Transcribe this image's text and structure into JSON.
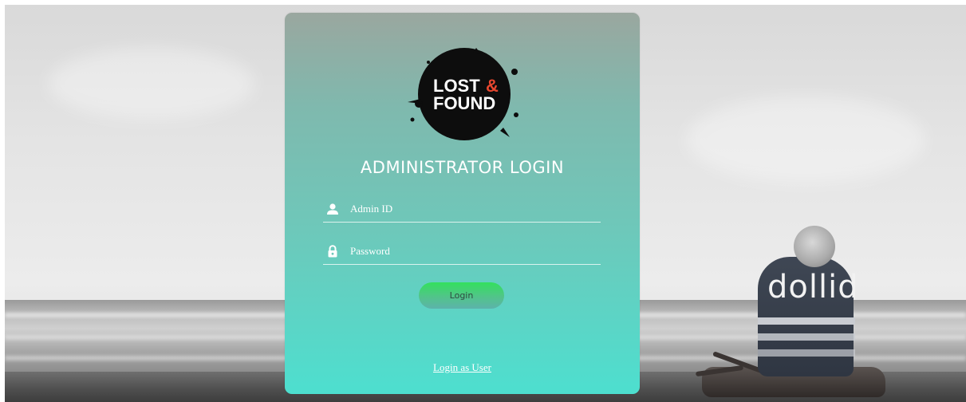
{
  "page": {
    "title": "ADMINISTRATOR LOGIN"
  },
  "logo": {
    "line1": "LOST",
    "ampersand": "&",
    "line2": "FOUND",
    "accent_color": "#e8472f"
  },
  "form": {
    "admin_id": {
      "placeholder": "Admin ID",
      "value": "",
      "icon": "user-icon"
    },
    "password": {
      "placeholder": "Password",
      "value": "",
      "icon": "lock-icon"
    },
    "submit_label": "Login"
  },
  "links": {
    "login_as_user": "Login as User"
  },
  "background": {
    "blanket_text": "dollid"
  },
  "colors": {
    "card_top": "#9aa79f",
    "card_bottom": "#4ddfcf",
    "button_top": "#33e05d",
    "text": "#ffffff"
  }
}
